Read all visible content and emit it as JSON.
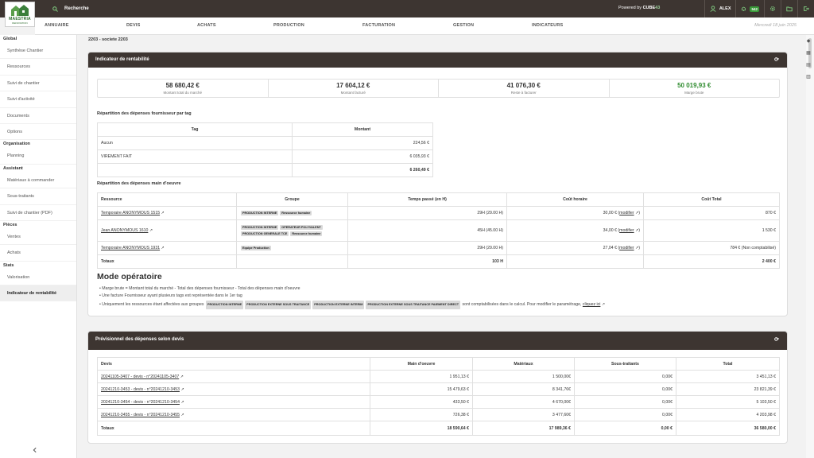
{
  "topbar": {
    "search_label": "Recherche",
    "powered_prefix": "Powered by",
    "powered_brand": "CUBE",
    "powered_num": "43",
    "user": "ALEX",
    "notif_count": "542",
    "logo_line1": "MAESTRIA",
    "logo_line2": "RENOVATION"
  },
  "nav": {
    "items": [
      "ANNUAIRE",
      "DEVIS",
      "ACHATS",
      "PRODUCTION",
      "FACTURATION",
      "GESTION",
      "INDICATEURS"
    ],
    "date": "Mercredi 18 juin 2025"
  },
  "sidebar": {
    "sections": [
      {
        "title": "Global",
        "items": [
          "Synthèse Chantier",
          "Ressources",
          "Suivi de chantier",
          "Suivi d'activité",
          "Documents",
          "Options"
        ]
      },
      {
        "title": "Organisation",
        "items": [
          "Planning"
        ]
      },
      {
        "title": "Assistant",
        "items": [
          "Matériaux à commander",
          "Sous-traitants",
          "Suivi de chantier (PDF)"
        ]
      },
      {
        "title": "Pièces",
        "items": [
          "Ventes",
          "Achats"
        ]
      },
      {
        "title": "Stats",
        "items": [
          "Valorisation",
          "Indicateur de rentabilité"
        ]
      }
    ],
    "collapse_icon": "chevron-left-icon"
  },
  "breadcrumb": "2203 - societe 2203",
  "rentabilite": {
    "title": "Indicateur de rentabilité",
    "kpis": [
      {
        "value": "58 680,42 €",
        "label": "Montant total du marché",
        "color": "#333333"
      },
      {
        "value": "17 604,12 €",
        "label": "Montant facturé",
        "color": "#333333"
      },
      {
        "value": "41 076,30 €",
        "label": "Reste à facturer",
        "color": "#333333"
      },
      {
        "value": "50 019,93 €",
        "label": "Marge brute",
        "color": "#2e8b2e"
      }
    ],
    "tags_title": "Répartition des dépenses fournisseur par tag",
    "tags_headers": [
      "Tag",
      "Montant"
    ],
    "tags_rows": [
      {
        "tag": "Aucun",
        "montant": "224,56 €"
      },
      {
        "tag": "VIREMENT FAIT",
        "montant": "6 035,93 €"
      }
    ],
    "tags_total": "6 260,49 €",
    "mo_title": "Répartition des dépenses main d'oeuvre",
    "mo_headers": [
      "Ressource",
      "Groupe",
      "Temps passé (en H)",
      "Coût horaire",
      "Coût Total"
    ],
    "mo_rows": [
      {
        "ressource": "Temporaire ANONYMOUS 1515",
        "groupes": [
          "PRODUCTION INTERNE",
          "Ressource humaine"
        ],
        "temps": "29H (29.00 H)",
        "cout": "30,00 €",
        "modifier": "modifier",
        "total": "870 €"
      },
      {
        "ressource": "Jean ANONYMOUS 1610",
        "groupes": [
          "PRODUCTION INTERNE",
          "OPERATEUR POLYVALENT",
          "PRODUCTION GENERALE TCE",
          "Ressource humaine"
        ],
        "temps": "45H (45.00 H)",
        "cout": "34,00 €",
        "modifier": "modifier",
        "total": "1 530 €"
      },
      {
        "ressource": "Temporaire ANONYMOUS 1931",
        "groupes": [
          "Equipe Production"
        ],
        "temps": "29H (29.00 H)",
        "cout": "27,04 €",
        "modifier": "modifier",
        "total": "784 € (Non comptabilisé)"
      }
    ],
    "mo_totals_label": "Totaux",
    "mo_totals_temps": "103 H",
    "mo_totals_total": "2 400 €",
    "mode_title": "Mode opératoire",
    "mode_lines": [
      "Marge brute = Montant total du marché - Total des dépenses fournisseur - Total des dépenses main d'oeuvre",
      "Une facture Fournisseur ayant plusieurs tags est représentée dans le 1er tag"
    ],
    "mode_line3_prefix": "Uniquement les ressources étant affectées aux groupes",
    "mode_line3_tags": [
      "PRODUCTION INTERNE",
      "PRODUCTION EXTERNE SOUS TRAITANCE",
      "PRODUCTION EXTERNE INTERIM",
      "PRODUCTION EXTERNE SOUS TRAITANCE PAIEMENT DIRECT"
    ],
    "mode_line3_suffix": "sont comptabilisées dans le calcul. Pour modifier le paramétrage,",
    "mode_line3_link": "cliquez ici"
  },
  "previsionnel": {
    "title": "Prévisionnel des dépenses selon devis",
    "headers": [
      "Devis",
      "Main d'oeuvre",
      "Matériaux",
      "Sous-traitants",
      "Total"
    ],
    "rows": [
      {
        "devis": "20241105-3407 - devis - n°20241105-3407",
        "mo": "1 951,13 €",
        "mat": "1 500,00€",
        "st": "0,00€",
        "total": "3 451,13 €"
      },
      {
        "devis": "20241210-3453 - devis - n°20241210-3453",
        "mo": "15 479,63 €",
        "mat": "8 341,76€",
        "st": "0,00€",
        "total": "23 821,39 €"
      },
      {
        "devis": "20241210-3454 - devis - n°20241210-3454",
        "mo": "433,50 €",
        "mat": "4 670,00€",
        "st": "0,00€",
        "total": "5 103,50 €"
      },
      {
        "devis": "20241210-3455 - devis - n°20241210-3455",
        "mo": "726,38 €",
        "mat": "3 477,60€",
        "st": "0,00€",
        "total": "4 203,98 €"
      }
    ],
    "totals": {
      "label": "Totaux",
      "mo": "18 590,64 €",
      "mat": "17 989,36 €",
      "st": "0,00 €",
      "total": "36 580,00 €"
    }
  }
}
